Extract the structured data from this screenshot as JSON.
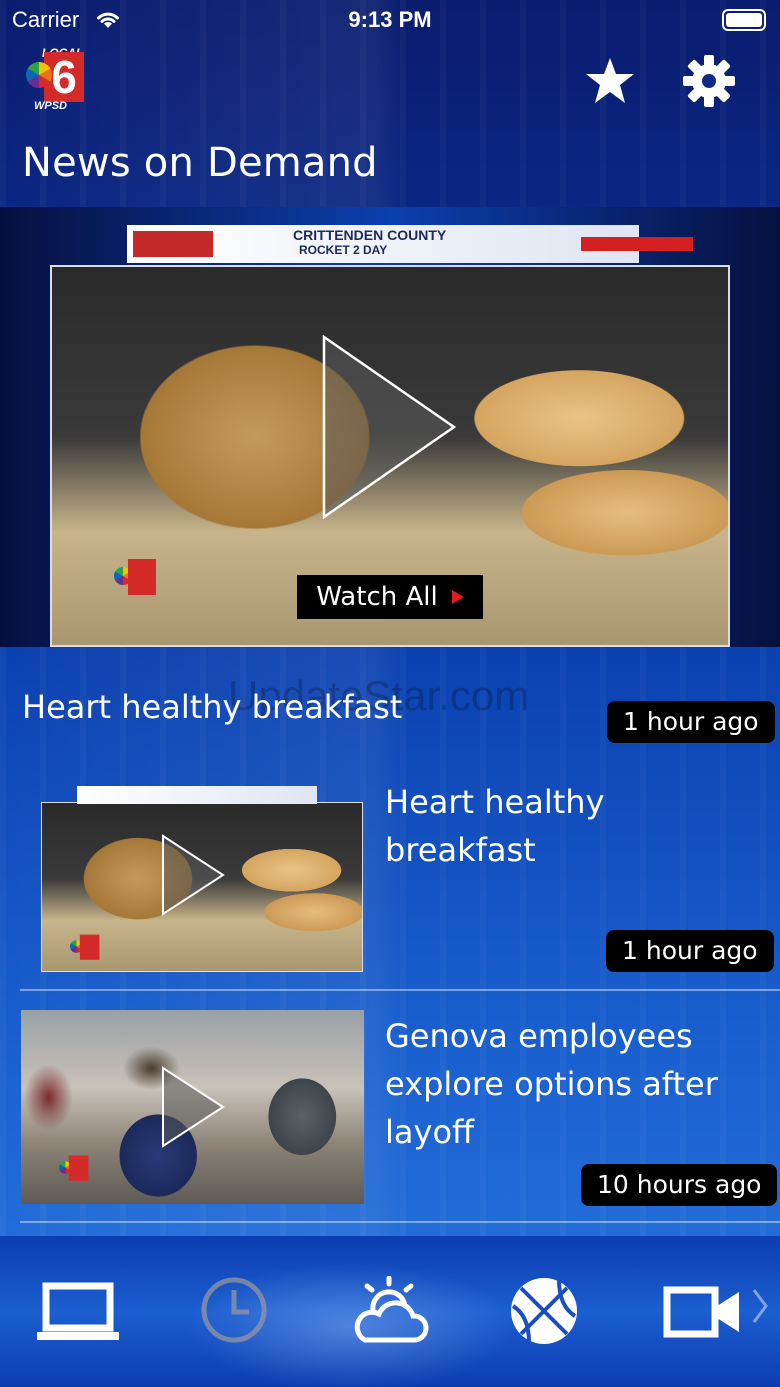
{
  "status_bar": {
    "carrier": "Carrier",
    "time": "9:13 PM"
  },
  "header": {
    "logo": {
      "text_local": "LOCAL",
      "text_number": "6",
      "text_station": "WPSD"
    },
    "title": "News on Demand",
    "icons": [
      "star-icon",
      "gear-icon"
    ]
  },
  "hero": {
    "lower_third_line1": "CRITTENDEN COUNTY",
    "lower_third_line2": "ROCKET 2 DAY",
    "watch_all_label": "Watch All"
  },
  "featured": {
    "title": "Heart healthy breakfast",
    "time": "1 hour ago"
  },
  "watermark": "UpdateStar.com",
  "videos": [
    {
      "title": "Heart healthy breakfast",
      "time": "1 hour ago"
    },
    {
      "title": "Genova employees explore options after layoff",
      "time": "10 hours ago"
    }
  ],
  "bottom_nav": {
    "icons": [
      "laptop-icon",
      "clock-icon",
      "weather-icon",
      "basketball-icon",
      "video-camera-icon",
      "chevron-right-icon"
    ]
  },
  "colors": {
    "background_top": "#0a1c6e",
    "background_bottom": "#2a77e0",
    "accent_red": "#e01c1c",
    "badge_bg": "#000000"
  }
}
